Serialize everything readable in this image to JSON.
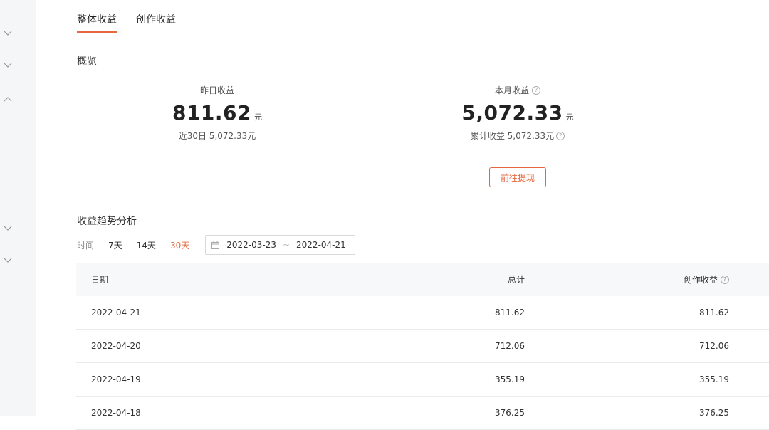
{
  "tabs": [
    {
      "label": "整体收益",
      "active": true
    },
    {
      "label": "创作收益",
      "active": false
    }
  ],
  "overview": {
    "title": "概览",
    "yesterday": {
      "label": "昨日收益",
      "value": "811.62",
      "unit": "元",
      "sub": "近30日 5,072.33元"
    },
    "month": {
      "label": "本月收益",
      "value": "5,072.33",
      "unit": "元",
      "sub": "累计收益 5,072.33元"
    },
    "withdraw_label": "前往提现"
  },
  "trend": {
    "title": "收益趋势分析",
    "time_label": "时间",
    "ranges": [
      {
        "label": "7天",
        "active": false
      },
      {
        "label": "14天",
        "active": false
      },
      {
        "label": "30天",
        "active": true
      }
    ],
    "date_start": "2022-03-23",
    "date_sep": "~",
    "date_end": "2022-04-21"
  },
  "table": {
    "headers": {
      "date": "日期",
      "total": "总计",
      "create": "创作收益"
    },
    "rows": [
      {
        "date": "2022-04-21",
        "total": "811.62",
        "create": "811.62"
      },
      {
        "date": "2022-04-20",
        "total": "712.06",
        "create": "712.06"
      },
      {
        "date": "2022-04-19",
        "total": "355.19",
        "create": "355.19"
      },
      {
        "date": "2022-04-18",
        "total": "376.25",
        "create": "376.25"
      }
    ]
  },
  "colors": {
    "accent": "#e5673e",
    "header_bg": "#f7f8fa",
    "sidebar_bg": "#f5f6f7"
  }
}
